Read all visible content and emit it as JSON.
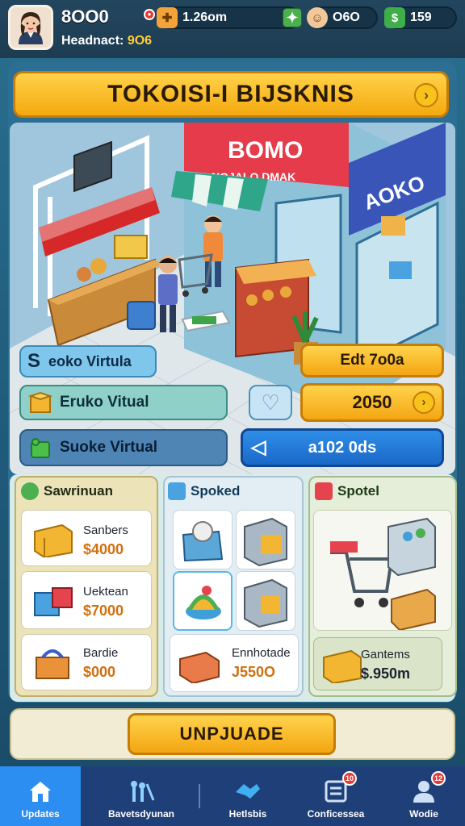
{
  "player": {
    "name": "8OO0",
    "sub_label": "Headnact:",
    "sub_value": "9O6"
  },
  "resources": [
    {
      "icon": "red-dot-icon",
      "value": "1.26om"
    },
    {
      "icon": "coin-icon",
      "value": "O6O"
    },
    {
      "icon": "cash-icon",
      "value": "159"
    }
  ],
  "title": {
    "text": "TOKOISI-I BIJSKNIS"
  },
  "scene": {
    "shop_sign_1": "BOMO",
    "shop_sign_2": "NOJALO DMAK",
    "shop_sign_3": "AOKO"
  },
  "rows": {
    "row1_label": "eoko Virtula",
    "row1_letter": "S",
    "row2_label": "Eruko Vitual",
    "row3_label": "Suoke Virtual",
    "edit_label": "Edt 7o0a",
    "price_label": "2050",
    "blue_label": "a102 0ds"
  },
  "columns": {
    "col1_title": "Sawrinuan",
    "col1_items": [
      {
        "name": "Sanbers",
        "price": "$4000"
      },
      {
        "name": "Uektean",
        "price": "$7000"
      },
      {
        "name": "Bardie",
        "price": "$000"
      }
    ],
    "col2_title": "Spoked",
    "col2_bottom": {
      "name": "Ennhotade",
      "price": "J550O"
    },
    "col3_title": "Spotel",
    "col3_bottom": {
      "name": "Gantems",
      "price": "$.950m"
    }
  },
  "upgrade": {
    "label": "UNPJUADE"
  },
  "nav": [
    {
      "label": "Updates",
      "icon": "home-icon",
      "active": true,
      "badge": ""
    },
    {
      "label": "Bavetsdyunan",
      "icon": "tools-icon",
      "active": false,
      "badge": ""
    },
    {
      "label": "Hetlsbis",
      "icon": "handshake-icon",
      "active": false,
      "badge": ""
    },
    {
      "label": "Conficessea",
      "icon": "list-icon",
      "active": false,
      "badge": "10"
    },
    {
      "label": "Wodie",
      "icon": "user-icon",
      "active": false,
      "badge": "12"
    }
  ],
  "colors": {
    "accent": "#f4a90f",
    "nav_active": "#2b8ef0",
    "price": "#d1700f"
  }
}
